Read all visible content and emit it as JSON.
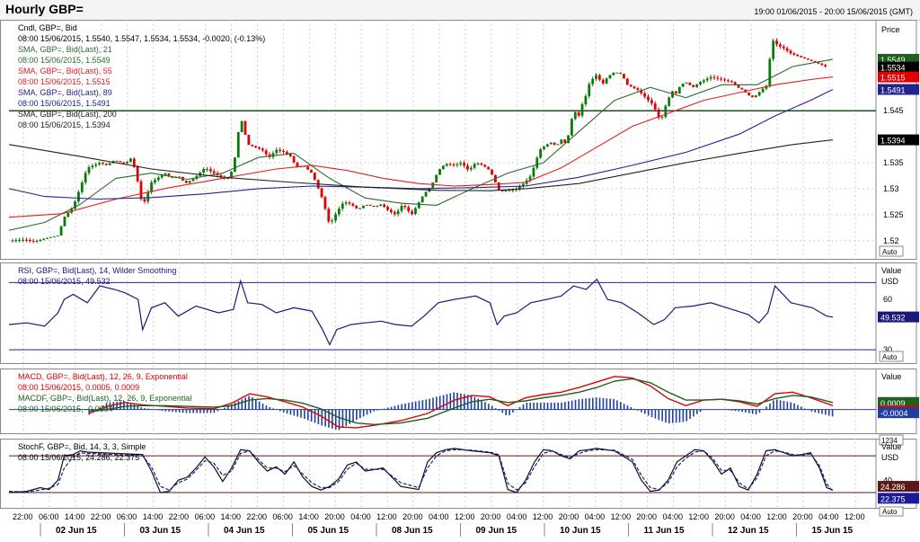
{
  "header": {
    "title": "Hourly GBP=",
    "range": "19:00 01/06/2015 - 20:00 15/06/2015 (GMT)"
  },
  "colors": {
    "up": "#0a7a0a",
    "down": "#e00000",
    "sma21": "#2e6b2e",
    "sma55": "#e02020",
    "sma89": "#23238e",
    "sma200": "#222222",
    "rsi": "#1a1a7a",
    "macd": "#e00000",
    "macdf": "#1f5f1f",
    "hist": "#1f3fa0",
    "stoch_k": "#111111",
    "stoch_d": "#1a1a9a"
  },
  "x_axis": {
    "time_labels": [
      "22:00",
      "06:00",
      "14:00",
      "22:00",
      "06:00",
      "14:00",
      "22:00",
      "06:00",
      "14:00",
      "22:00",
      "06:00",
      "14:00",
      "20:00",
      "04:00",
      "12:00",
      "20:00",
      "04:00",
      "12:00",
      "20:00",
      "04:00",
      "12:00",
      "20:00",
      "04:00",
      "12:00",
      "20:00",
      "04:00",
      "12:00",
      "20:00",
      "04:00",
      "12:00",
      "20:00",
      "04:00",
      "12:00"
    ],
    "day_labels": [
      "02 Jun 15",
      "03 Jun 15",
      "04 Jun 15",
      "05 Jun 15",
      "08 Jun 15",
      "09 Jun 15",
      "10 Jun 15",
      "11 Jun 15",
      "12 Jun 15",
      "15 Jun 15"
    ]
  },
  "chart_data": [
    {
      "type": "candlestick",
      "panel": "price",
      "legend": [
        {
          "text": "Cndl, GBP=, Bid",
          "color": "#000000"
        },
        {
          "text": "08:00 15/06/2015, 1.5540, 1.5547, 1.5534, 1.5534, -0.0020, (-0.13%)",
          "color": "#000000"
        },
        {
          "text": "SMA, GBP=, Bid(Last), 21",
          "color": "#2e6b2e"
        },
        {
          "text": "08:00 15/06/2015, 1.5549",
          "color": "#2e6b2e"
        },
        {
          "text": "SMA, GBP=, Bid(Last), 55",
          "color": "#e02020"
        },
        {
          "text": "08:00 15/06/2015, 1.5515",
          "color": "#e02020"
        },
        {
          "text": "SMA, GBP=, Bid(Last), 89",
          "color": "#23238e"
        },
        {
          "text": "08:00 15/06/2015, 1.5491",
          "color": "#23238e"
        },
        {
          "text": "SMA, GBP=, Bid(Last), 200",
          "color": "#222222"
        },
        {
          "text": "08:00 15/06/2015, 1.5394",
          "color": "#222222"
        }
      ],
      "axis_title": "Price",
      "ylim": [
        1.5165,
        1.5625
      ],
      "y_ticks": [
        1.52,
        1.525,
        1.53,
        1.535,
        1.545
      ],
      "horizontal_line": 1.545,
      "tags": [
        {
          "value": 1.5549,
          "label": "1.5549",
          "color": "#1f5f1f"
        },
        {
          "value": 1.5534,
          "label": "1.5534",
          "color": "#000000"
        },
        {
          "value": 1.5515,
          "label": "1.5515",
          "color": "#e00000"
        },
        {
          "value": 1.5491,
          "label": "1.5491",
          "color": "#23238e"
        },
        {
          "value": 1.5394,
          "label": "1.5394",
          "color": "#000000"
        }
      ],
      "auto_label": "Auto",
      "price_path": {
        "t": [
          0,
          18,
          28,
          42,
          55,
          62,
          72,
          88,
          102,
          110,
          118,
          130,
          138,
          145,
          150,
          160,
          175,
          182,
          190,
          198,
          208,
          220,
          235,
          245,
          252,
          260,
          268,
          276,
          284,
          292,
          300,
          310,
          318,
          322,
          330,
          340,
          345,
          352,
          360,
          368,
          376,
          384,
          392,
          400,
          410,
          418,
          426,
          434,
          442,
          452,
          466,
          474,
          482,
          490,
          500,
          508,
          516,
          524,
          532,
          540,
          548,
          552,
          556,
          560,
          570,
          578,
          586,
          596,
          604,
          610,
          614,
          620,
          626,
          630,
          634,
          640,
          644,
          648,
          652,
          660,
          666,
          672,
          680,
          688,
          694,
          700,
          706,
          712,
          718,
          724,
          728,
          732,
          736,
          740,
          744,
          748,
          754,
          760,
          768,
          776,
          788,
          800,
          812,
          818,
          824,
          830,
          836,
          842,
          848,
          852,
          856,
          860,
          864,
          870,
          878,
          886,
          894,
          902,
          910,
          918,
          925
        ],
        "v": [
          1.52,
          1.5202,
          1.5198,
          1.5205,
          1.521,
          1.5245,
          1.5265,
          1.534,
          1.535,
          1.5345,
          1.5355,
          1.5348,
          1.536,
          1.531,
          1.5265,
          1.5312,
          1.533,
          1.532,
          1.5325,
          1.531,
          1.532,
          1.534,
          1.5325,
          1.5318,
          1.534,
          1.544,
          1.5385,
          1.538,
          1.5375,
          1.536,
          1.5375,
          1.537,
          1.536,
          1.534,
          1.5345,
          1.533,
          1.531,
          1.528,
          1.523,
          1.5255,
          1.5275,
          1.527,
          1.526,
          1.527,
          1.5265,
          1.527,
          1.5258,
          1.525,
          1.527,
          1.525,
          1.529,
          1.5305,
          1.5335,
          1.5348,
          1.5345,
          1.535,
          1.5335,
          1.535,
          1.5345,
          1.5335,
          1.5305,
          1.529,
          1.53,
          1.5295,
          1.53,
          1.531,
          1.5325,
          1.5375,
          1.5385,
          1.539,
          1.538,
          1.5395,
          1.5385,
          1.542,
          1.545,
          1.544,
          1.5465,
          1.548,
          1.5505,
          1.552,
          1.55,
          1.5515,
          1.5525,
          1.552,
          1.55,
          1.5495,
          1.549,
          1.548,
          1.547,
          1.546,
          1.544,
          1.543,
          1.5455,
          1.547,
          1.549,
          1.548,
          1.55,
          1.5505,
          1.5495,
          1.5505,
          1.5515,
          1.551,
          1.5505,
          1.5495,
          1.549,
          1.548,
          1.5475,
          1.5485,
          1.5495,
          1.55,
          1.559,
          1.558,
          1.5575,
          1.557,
          1.556,
          1.5555,
          1.555,
          1.5545,
          1.554,
          1.5534
        ]
      },
      "sma_series": [
        {
          "name": "SMA 21",
          "t": [
            0,
            40,
            80,
            120,
            160,
            200,
            240,
            280,
            320,
            360,
            400,
            440,
            480,
            520,
            560,
            600,
            640,
            680,
            720,
            760,
            800,
            840,
            880,
            925
          ],
          "v": [
            1.522,
            1.5235,
            1.527,
            1.532,
            1.533,
            1.5318,
            1.533,
            1.536,
            1.5368,
            1.532,
            1.5282,
            1.5272,
            1.5268,
            1.53,
            1.533,
            1.535,
            1.541,
            1.547,
            1.5495,
            1.5475,
            1.55,
            1.55,
            1.5535,
            1.5549
          ],
          "color": "#2e6b2e"
        },
        {
          "name": "SMA 55",
          "t": [
            0,
            60,
            120,
            180,
            240,
            300,
            340,
            380,
            420,
            460,
            500,
            540,
            580,
            620,
            660,
            700,
            740,
            780,
            820,
            860,
            900,
            925
          ],
          "v": [
            1.5245,
            1.5252,
            1.528,
            1.5302,
            1.532,
            1.5338,
            1.5345,
            1.5335,
            1.532,
            1.531,
            1.5305,
            1.5308,
            1.5312,
            1.534,
            1.538,
            1.542,
            1.5445,
            1.547,
            1.5485,
            1.55,
            1.551,
            1.5515
          ],
          "color": "#e02020"
        },
        {
          "name": "SMA 89",
          "t": [
            0,
            40,
            100,
            160,
            220,
            280,
            340,
            400,
            460,
            520,
            580,
            640,
            700,
            760,
            820,
            860,
            900,
            925
          ],
          "v": [
            1.53,
            1.5285,
            1.528,
            1.5283,
            1.529,
            1.53,
            1.5305,
            1.5303,
            1.53,
            1.5302,
            1.5305,
            1.5322,
            1.5345,
            1.537,
            1.5405,
            1.544,
            1.547,
            1.5491
          ],
          "color": "#23238e"
        },
        {
          "name": "SMA 200",
          "t": [
            0,
            80,
            160,
            240,
            320,
            400,
            480,
            540,
            580,
            640,
            700,
            760,
            820,
            880,
            925
          ],
          "v": [
            1.5385,
            1.5362,
            1.5338,
            1.5322,
            1.5312,
            1.5303,
            1.5297,
            1.5296,
            1.53,
            1.531,
            1.533,
            1.535,
            1.5368,
            1.5385,
            1.5394
          ],
          "color": "#222222"
        }
      ]
    },
    {
      "type": "line",
      "panel": "rsi",
      "legend": [
        {
          "text": "RSI, GBP=, Bid(Last), 14, Wilder Smoothing",
          "color": "#1a1a7a"
        },
        {
          "text": "08:00 15/06/2015, 49.532",
          "color": "#1a1a7a"
        }
      ],
      "axis_title": "Value",
      "axis_unit": "USD",
      "ylim": [
        22,
        82
      ],
      "levels": [
        70,
        30
      ],
      "y_ticks": [
        60,
        30
      ],
      "tag": {
        "value": 49.532,
        "label": "49.532",
        "color": "#1a1a7a"
      },
      "auto_label": "Auto",
      "t": [
        0,
        20,
        40,
        55,
        62,
        72,
        88,
        102,
        118,
        130,
        145,
        150,
        160,
        175,
        190,
        210,
        235,
        252,
        260,
        268,
        284,
        300,
        320,
        340,
        352,
        360,
        368,
        384,
        400,
        418,
        434,
        452,
        466,
        482,
        500,
        524,
        540,
        548,
        556,
        570,
        586,
        604,
        620,
        634,
        648,
        660,
        672,
        688,
        706,
        724,
        736,
        748,
        768,
        788,
        812,
        830,
        842,
        852,
        860,
        878,
        902,
        918,
        925
      ],
      "v": [
        45,
        46,
        44,
        52,
        60,
        63,
        58,
        68,
        66,
        64,
        60,
        42,
        55,
        58,
        50,
        56,
        52,
        54,
        71,
        58,
        57,
        52,
        55,
        53,
        42,
        33,
        42,
        45,
        46,
        47,
        45,
        44,
        50,
        58,
        60,
        62,
        58,
        45,
        50,
        52,
        58,
        60,
        62,
        68,
        66,
        72,
        60,
        58,
        52,
        45,
        48,
        55,
        56,
        58,
        54,
        51,
        46,
        52,
        68,
        58,
        55,
        50,
        49.5
      ],
      "color": "#1a1a7a"
    },
    {
      "type": "line",
      "panel": "macd",
      "legend": [
        {
          "text": "MACD, GBP=, Bid(Last), 12, 26, 9, Exponential",
          "color": "#e00000"
        },
        {
          "text": "08:00 15/06/2015, 0.0005, 0.0009",
          "color": "#e00000"
        },
        {
          "text": "MACDF, GBP=, Bid(Last), 12, 26, 9, Exponential",
          "color": "#1f5f1f"
        },
        {
          "text": "08:00 15/06/2015, -0.0004",
          "color": "#1f5f1f"
        }
      ],
      "axis_title": "Value",
      "ylim": [
        -0.003,
        0.0052
      ],
      "zero_line": 0,
      "tags": [
        {
          "value": 0.0009,
          "label": "0.0009",
          "color": "#1f5f1f"
        },
        {
          "value": 0.0005,
          "label": "0.0005",
          "color": "#e00000"
        },
        {
          "value": -0.0004,
          "label": "-0.0004",
          "color": "#1f3fa0"
        }
      ],
      "bottom_label": "1234",
      "t": [
        90,
        110,
        130,
        150,
        175,
        200,
        230,
        250,
        270,
        290,
        310,
        330,
        350,
        370,
        390,
        410,
        440,
        470,
        500,
        520,
        540,
        560,
        580,
        600,
        620,
        640,
        660,
        680,
        700,
        720,
        740,
        760,
        780,
        800,
        820,
        840,
        860,
        880,
        900,
        925
      ],
      "macd": [
        -0.0005,
        0.0004,
        0.0009,
        0.0006,
        0.0004,
        0.0002,
        0.0001,
        0.0008,
        0.002,
        0.0016,
        0.001,
        0.0003,
        -0.0008,
        -0.0022,
        -0.0023,
        -0.002,
        -0.0014,
        -0.0005,
        0.0012,
        0.0018,
        0.0016,
        0.0005,
        0.0015,
        0.0019,
        0.0022,
        0.0028,
        0.0035,
        0.0042,
        0.004,
        0.003,
        0.0014,
        0.0005,
        0.0012,
        0.0013,
        0.001,
        0.0004,
        0.002,
        0.0022,
        0.0015,
        0.0005
      ],
      "signal": [
        -0.0002,
        0.0,
        0.0004,
        0.0005,
        0.0005,
        0.0004,
        0.0003,
        0.0005,
        0.0012,
        0.0014,
        0.0012,
        0.0008,
        0.0001,
        -0.001,
        -0.0017,
        -0.0019,
        -0.0017,
        -0.0011,
        0.0002,
        0.001,
        0.0013,
        0.0009,
        0.0011,
        0.0015,
        0.0018,
        0.0022,
        0.0028,
        0.0036,
        0.0039,
        0.0034,
        0.0022,
        0.0012,
        0.0012,
        0.0013,
        0.0011,
        0.0007,
        0.0014,
        0.0018,
        0.0016,
        0.0009
      ],
      "colors": {
        "macd": "#e00000",
        "signal": "#1f5f1f",
        "hist": "#1f3fa0"
      }
    },
    {
      "type": "line",
      "panel": "stochastic",
      "legend": [
        {
          "text": "StochF, GBP=, Bid, 14, 3, 3, Simple",
          "color": "#000000"
        },
        {
          "text": "08:00 15/06/2015, 24.286, 22.375",
          "color": "#000000"
        }
      ],
      "axis_title": "Value",
      "axis_unit": "USD",
      "ylim": [
        -5,
        108
      ],
      "levels": [
        80,
        20
      ],
      "y_ticks": [
        40
      ],
      "tags": [
        {
          "value": 24.286,
          "label": "24.286",
          "color": "#5a1a1a"
        },
        {
          "value": 22.375,
          "label": "22.375",
          "color": "#1a1a9a"
        }
      ],
      "auto_label": "Auto",
      "t": [
        0,
        20,
        35,
        45,
        55,
        62,
        72,
        80,
        88,
        150,
        160,
        170,
        180,
        190,
        200,
        210,
        220,
        230,
        240,
        250,
        260,
        270,
        280,
        290,
        300,
        310,
        320,
        330,
        340,
        350,
        360,
        370,
        380,
        390,
        400,
        420,
        440,
        460,
        470,
        480,
        490,
        500,
        520,
        540,
        550,
        560,
        570,
        580,
        590,
        600,
        610,
        620,
        630,
        640,
        650,
        660,
        680,
        700,
        710,
        720,
        730,
        740,
        750,
        760,
        770,
        780,
        790,
        800,
        810,
        820,
        830,
        840,
        850,
        860,
        870,
        880,
        890,
        900,
        910,
        918,
        925
      ],
      "k": [
        20,
        22,
        28,
        25,
        40,
        80,
        82,
        88,
        86,
        82,
        55,
        20,
        22,
        40,
        45,
        60,
        78,
        62,
        38,
        60,
        90,
        88,
        70,
        55,
        62,
        50,
        70,
        45,
        30,
        24,
        30,
        42,
        65,
        70,
        55,
        60,
        30,
        25,
        70,
        85,
        90,
        92,
        88,
        85,
        80,
        25,
        20,
        40,
        70,
        90,
        88,
        80,
        75,
        88,
        90,
        92,
        88,
        70,
        40,
        22,
        24,
        40,
        70,
        80,
        90,
        88,
        72,
        50,
        60,
        30,
        24,
        50,
        88,
        90,
        85,
        80,
        82,
        85,
        60,
        28,
        24
      ],
      "d": [
        22,
        21,
        24,
        27,
        33,
        60,
        78,
        85,
        84,
        80,
        62,
        30,
        24,
        36,
        42,
        56,
        72,
        68,
        48,
        55,
        84,
        88,
        74,
        60,
        60,
        54,
        64,
        50,
        36,
        28,
        28,
        38,
        58,
        68,
        58,
        58,
        36,
        28,
        60,
        80,
        88,
        90,
        89,
        86,
        82,
        35,
        24,
        36,
        62,
        84,
        88,
        82,
        77,
        84,
        88,
        90,
        89,
        74,
        48,
        28,
        25,
        36,
        62,
        76,
        86,
        88,
        76,
        56,
        56,
        36,
        26,
        44,
        80,
        88,
        86,
        82,
        81,
        83,
        64,
        34,
        22
      ],
      "colors": {
        "k": "#111111",
        "d": "#1a1a9a"
      }
    }
  ]
}
